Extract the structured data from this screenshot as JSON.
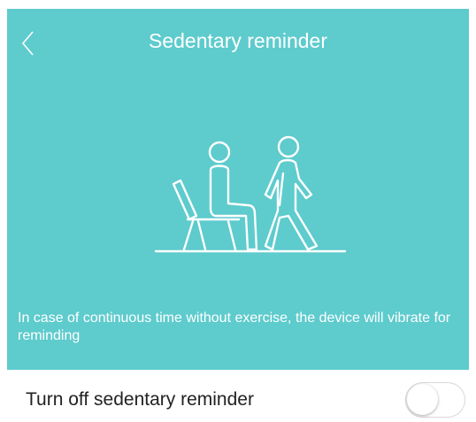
{
  "colors": {
    "header_bg": "#5ecbcd",
    "text_on_header": "#ffffff",
    "row_text": "#222222",
    "toggle_border": "#d8d8d8"
  },
  "header": {
    "title": "Sedentary reminder",
    "back_icon": "chevron-left-icon",
    "illustration_icon": "sit-and-walk-illustration",
    "description": "In case of continuous time without exercise, the device will vibrate for reminding"
  },
  "setting": {
    "label": "Turn off sedentary reminder",
    "toggle_on": false
  }
}
